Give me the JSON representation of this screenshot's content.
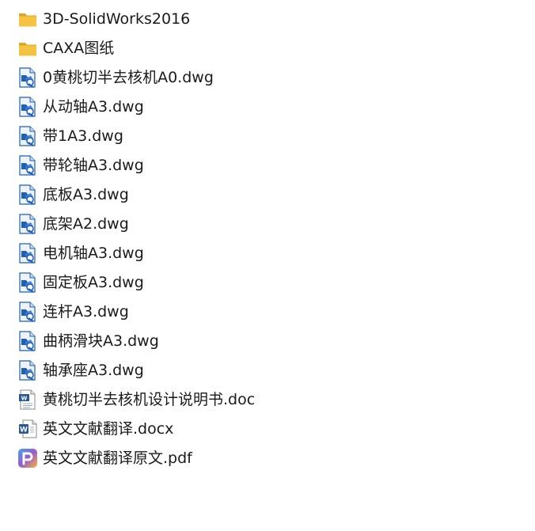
{
  "files": [
    {
      "name": "3D-SolidWorks2016",
      "icon": "folder-icon"
    },
    {
      "name": "CAXA图纸",
      "icon": "folder-icon"
    },
    {
      "name": "0黄桃切半去核机A0.dwg",
      "icon": "dwg-file-icon"
    },
    {
      "name": "从动轴A3.dwg",
      "icon": "dwg-file-icon"
    },
    {
      "name": "带1A3.dwg",
      "icon": "dwg-file-icon"
    },
    {
      "name": "带轮轴A3.dwg",
      "icon": "dwg-file-icon"
    },
    {
      "name": "底板A3.dwg",
      "icon": "dwg-file-icon"
    },
    {
      "name": "底架A2.dwg",
      "icon": "dwg-file-icon"
    },
    {
      "name": "电机轴A3.dwg",
      "icon": "dwg-file-icon"
    },
    {
      "name": "固定板A3.dwg",
      "icon": "dwg-file-icon"
    },
    {
      "name": "连杆A3.dwg",
      "icon": "dwg-file-icon"
    },
    {
      "name": "曲柄滑块A3.dwg",
      "icon": "dwg-file-icon"
    },
    {
      "name": "轴承座A3.dwg",
      "icon": "dwg-file-icon"
    },
    {
      "name": "黄桃切半去核机设计说明书.doc",
      "icon": "doc-file-icon"
    },
    {
      "name": "英文文献翻译.docx",
      "icon": "docx-file-icon"
    },
    {
      "name": "英文文献翻译原文.pdf",
      "icon": "pdf-file-icon"
    }
  ],
  "colors": {
    "folder": "#f5c342",
    "folder_dark": "#e0a526",
    "dwg_blue": "#1f5fb4",
    "word_blue": "#2b579a",
    "pdf_gradient": [
      "#f0483e",
      "#f7b733",
      "#3aa6f0"
    ]
  }
}
